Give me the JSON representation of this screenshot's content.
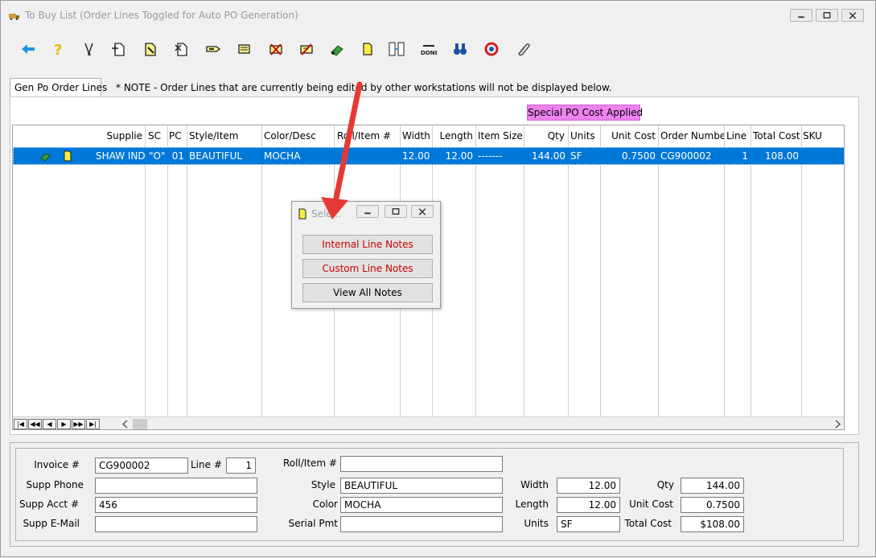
{
  "window": {
    "title": "To Buy List  (Order Lines Toggled for Auto PO Generation)"
  },
  "toolbar": {
    "icons": [
      "back-arrow-icon",
      "help-icon",
      "tools-icon",
      "new-page-icon",
      "edit-page-icon",
      "delete-page-icon",
      "tag-icon",
      "note-stack-icon",
      "cancel-icon",
      "block-icon",
      "eraser-icon",
      "note-icon",
      "split-icon",
      "done-icon",
      "binoculars-icon",
      "refresh-icon",
      "paperclip-icon"
    ],
    "done_label": "DONE"
  },
  "tabs": {
    "active": "Gen Po Order Lines"
  },
  "note": "* NOTE - Order Lines that are currently being edited by other workstations will not be displayed below.",
  "special_badge": "Special PO Cost Applied",
  "colors": {
    "accent": "#0078d7",
    "badge": "#ee82ee",
    "link_red": "#d00000"
  },
  "grid": {
    "headers": {
      "supplier": "Supplie",
      "sc": "SC",
      "pc": "PC",
      "style": "Style/Item",
      "color": "Color/Desc",
      "roll": "Roll/Item #",
      "width": "Width",
      "length": "Length",
      "item_size": "Item Size",
      "qty": "Qty",
      "units": "Units",
      "unit_cost": "Unit Cost",
      "order_number": "Order Number",
      "line": "Line",
      "total_cost": "Total Cost",
      "sku": "SKU"
    },
    "row": {
      "supplier": "SHAW IND",
      "sc": "\"O\"",
      "pc": "01",
      "style": "BEAUTIFUL",
      "color": "MOCHA",
      "roll": "",
      "width": "12.00",
      "length": "12.00",
      "item_size": "-------",
      "qty": "144.00",
      "units": "SF",
      "unit_cost": "0.7500",
      "order_number": "CG900002",
      "line": "1",
      "total_cost": "108.00",
      "sku": ""
    }
  },
  "dialog": {
    "title": "Sele...",
    "buttons": [
      "Internal Line Notes",
      "Custom Line Notes",
      "View All Notes"
    ]
  },
  "detail": {
    "invoice_label": "Invoice #",
    "invoice": "CG900002",
    "line_label": "Line #",
    "line": "1",
    "supp_phone_label": "Supp Phone",
    "supp_phone": "",
    "supp_acct_label": "Supp Acct #",
    "supp_acct": "456",
    "supp_email_label": "Supp E-Mail",
    "supp_email": "",
    "roll_label": "Roll/Item #",
    "roll": "",
    "style_label": "Style",
    "style": "BEAUTIFUL",
    "color_label": "Color",
    "color": "MOCHA",
    "serial_label": "Serial Pmt",
    "serial": "",
    "width_label": "Width",
    "width": "12.00",
    "length_label": "Length",
    "length": "12.00",
    "units_label": "Units",
    "units": "SF",
    "qty_label": "Qty",
    "qty": "144.00",
    "unit_cost_label": "Unit Cost",
    "unit_cost": "0.7500",
    "total_cost_label": "Total Cost",
    "total_cost": "$108.00"
  }
}
